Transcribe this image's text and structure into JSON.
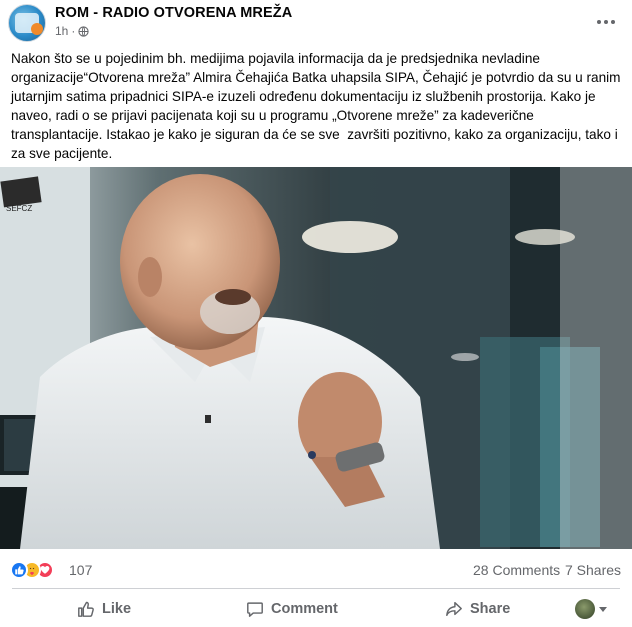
{
  "post": {
    "page_name": "ROM - RADIO OTVORENA MREŽA",
    "time": "1h",
    "separator": "·",
    "audience_icon": "globe-icon",
    "text": "Nakon što se u pojedinim bh. medijima pojavila informacija da je predsjednika nevladine organizacije“Otvorena mreža” Almira Čehajića Batka uhapsila SIPA, Čehajić je potvrdio da su u ranim jutarnjim satima pripadnici SIPA-e izuzeli određenu dokumentaciju iz službenih prostorija. Kako je naveo, radi o se prijavi pacijenata koji su u programu „Otvorene mreže” za kadeverične transplantacije. Istakao je kako je siguran da će se sve  završiti pozitivno, kako za organizaciju, tako i za sve pacijente.",
    "photo_sign_text": "SEFCZ"
  },
  "stats": {
    "reaction_icons": [
      "like-icon",
      "care-icon",
      "love-icon"
    ],
    "reaction_count": "107",
    "comments": "28 Comments",
    "shares": "7 Shares"
  },
  "actions": {
    "like": "Like",
    "comment": "Comment",
    "share": "Share"
  },
  "colors": {
    "text": "#050505",
    "secondary": "#65676b",
    "like_blue": "#1877f2",
    "love_red": "#f33e58",
    "care_yellow": "#f7b928",
    "divider": "#ced0d4"
  }
}
